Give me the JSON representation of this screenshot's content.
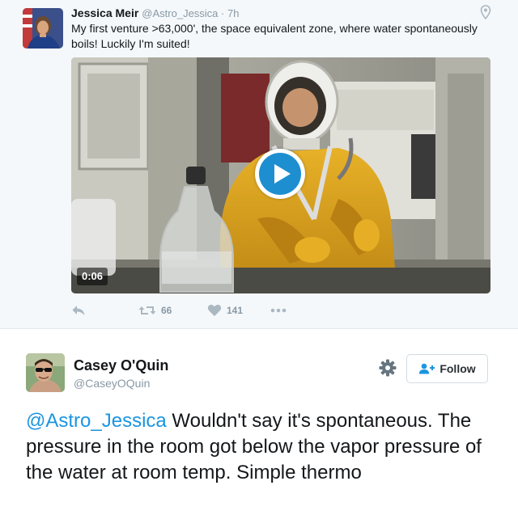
{
  "tweet": {
    "author_name": "Jessica Meir",
    "author_handle": "@Astro_Jessica",
    "timestamp": "7h",
    "text": "My first venture >63,000', the space equivalent zone, where water spontaneously boils! Luckily I'm suited!",
    "video_duration": "0:06",
    "retweet_count": "66",
    "like_count": "141"
  },
  "reply": {
    "author_name": "Casey O'Quin",
    "author_handle": "@CaseyOQuin",
    "follow_label": "Follow",
    "mention": "@Astro_Jessica",
    "text": " Wouldn't say it's spontaneous. The pressure in the room got below the vapor pressure of the water at room temp. Simple thermo"
  },
  "colors": {
    "link": "#1b95e0",
    "muted": "#8899a6",
    "play_button": "#1d8fd1",
    "top_background": "#f5f8fa"
  },
  "icons": [
    "location-pin-icon",
    "play-icon",
    "reply-icon",
    "retweet-icon",
    "heart-icon",
    "more-icon",
    "gear-icon",
    "add-user-icon"
  ]
}
